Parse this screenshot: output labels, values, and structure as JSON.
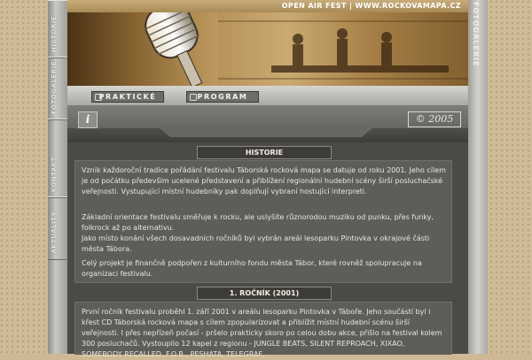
{
  "banner": {
    "top_text": "OPEN AIR FEST  |  WWW.ROCKOVAMAPA.CZ"
  },
  "side_tabs": [
    "HISTORIE",
    "FOTOGALERIE",
    "KONTAKT",
    "AKTUALITY"
  ],
  "right_rail": "FOTOGALERIE",
  "nav": {
    "practical_label": "PRAKTICKÉ",
    "program_label": "PROGRAM"
  },
  "info_icon": "i",
  "copyright": "© 2005",
  "sections": [
    {
      "heading": "HISTORIE",
      "paragraphs": [
        "Vznik každoroční tradice pořádání festivalu Táborská rocková mapa se datuje od roku 2001. Jeho cílem je od počátku především ucelené představení a přiblížení regionální hudební scény širší posluchačské veřejnosti. Vystupující místní hudebníky pak doplňují vybraní hostující interpreti.",
        "Základní orientace festivalu směřuje k rocku, ale uslyšíte různorodou muziku od punku, přes funky, folkrock až po alternativu.",
        "Jako místo konání všech dosavadních ročníků byl vybrán areál lesoparku Pintovka v okrajové části města Tábora.",
        "Celý projekt je finančně podpořen z kulturního fondu města Tábor, které rovněž spolupracuje na organizaci festivalu."
      ]
    },
    {
      "heading": "1. ROČNÍK (2001)",
      "paragraphs": [
        "První ročník festivalu proběhl 1. září 2001 v areálu lesoparku Pintovka v Táboře. Jeho součástí byl i křest CD Táborská rocková mapa s cílem zpopularizovat a přiblížit místní hudební scénu širší veřejnosti. I přes nepřízeň počasí - pršelo prakticky skoro po celou dobu akce, přišlo na festival kolem 300 posluchačů. Vystoupilo 12 kapel z regionu - JUNGLE BEATS, SILENT REPROACH, XIXAO, SOMEBODY RECALLED, F.O.B., PESHATA, TELEGRAF,"
      ]
    }
  ]
}
